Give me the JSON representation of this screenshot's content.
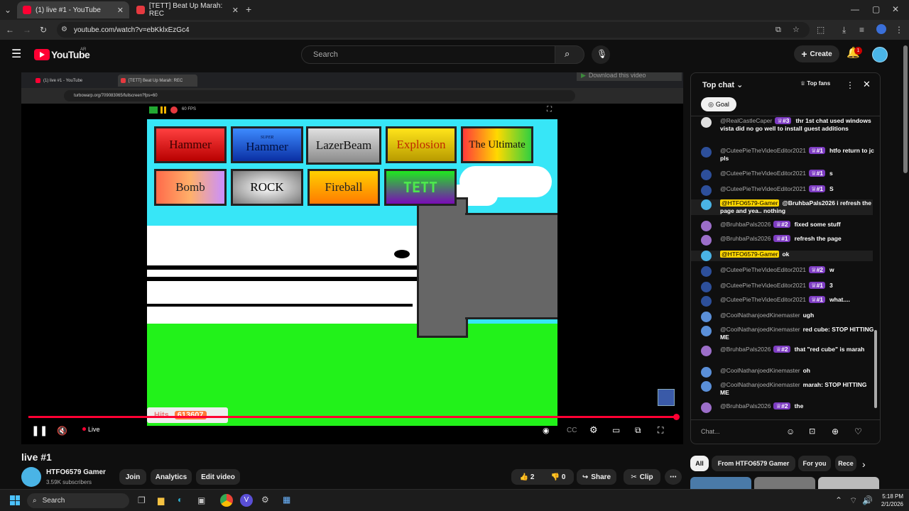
{
  "browser": {
    "tabs": [
      {
        "title": "(1) live #1 - YouTube",
        "active": true
      },
      {
        "title": "[TETT] Beat Up Marah: REC",
        "active": false
      }
    ],
    "url": "youtube.com/watch?v=ebKklxEzGc4"
  },
  "youtube": {
    "logo": "YouTube",
    "region": "AR",
    "search_placeholder": "Search",
    "create_label": "Create",
    "notif_count": "1"
  },
  "video": {
    "inner_tabs": [
      "(1) live #1 - YouTube",
      "[TETT] Beat Up Marah: REC"
    ],
    "inner_url": "turbowarp.org/709083065/fullscreen?fps=60",
    "fps": "60 FPS",
    "download_label": "Download this video",
    "weapons": [
      "Hammer",
      "Hammer",
      "LazerBeam",
      "Explosion",
      "The Ultimate",
      "Bomb",
      "ROCK",
      "Fireball",
      "TETT"
    ],
    "super_label": "SUPER",
    "hits_label": "Hits",
    "hits_value": "613607",
    "live_label": "Live",
    "progress_fraction": 1.0
  },
  "meta": {
    "title": "live #1",
    "channel": "HTFO6579 Gamer",
    "subscribers": "3.59K subscribers",
    "join": "Join",
    "analytics": "Analytics",
    "edit": "Edit video",
    "likes": "2",
    "dislikes": "0",
    "share": "Share",
    "clip": "Clip"
  },
  "chat": {
    "header": "Top chat",
    "top_fans": "Top fans",
    "goal": "Goal",
    "input_placeholder": "Chat...",
    "messages": [
      {
        "name": "@RealCastleCaper",
        "badge": "#3",
        "text": "thr 1st chat used windows vista did no go well to install guest additions",
        "highlight": false
      },
      {
        "name": "@CuteePieTheVideoEditor2021",
        "badge": "#1",
        "text": "htfo return to jc pls",
        "highlight": false
      },
      {
        "name": "@CuteePieTheVideoEditor2021",
        "badge": "#1",
        "text": "s",
        "highlight": false
      },
      {
        "name": "@CuteePieTheVideoEditor2021",
        "badge": "#1",
        "text": "S",
        "highlight": false
      },
      {
        "name": "@HTFO6579-Gamer",
        "badge": "",
        "text": "@BruhbaPals2026 i refresh the page and yea.. nothing",
        "highlight": true
      },
      {
        "name": "@BruhbaPals2026",
        "badge": "#2",
        "text": "fixed some stuff",
        "highlight": false
      },
      {
        "name": "@BruhbaPals2026",
        "badge": "#1",
        "text": "refresh the page",
        "highlight": false
      },
      {
        "name": "@HTFO6579-Gamer",
        "badge": "",
        "text": "ok",
        "highlight": true
      },
      {
        "name": "@CuteePieTheVideoEditor2021",
        "badge": "#2",
        "text": "w",
        "highlight": false
      },
      {
        "name": "@CuteePieTheVideoEditor2021",
        "badge": "#1",
        "text": "3",
        "highlight": false
      },
      {
        "name": "@CuteePieTheVideoEditor2021",
        "badge": "#1",
        "text": "what....",
        "highlight": false
      },
      {
        "name": "@CoolNathanjoedKinemaster",
        "badge": "",
        "text": "ugh",
        "highlight": false
      },
      {
        "name": "@CoolNathanjoedKinemaster",
        "badge": "",
        "text": "red cube: STOP HITTING ME",
        "highlight": false
      },
      {
        "name": "@BruhbaPals2026",
        "badge": "#2",
        "text": "that \"red cube\" is marah",
        "highlight": false
      },
      {
        "name": "@CoolNathanjoedKinemaster",
        "badge": "",
        "text": "oh",
        "highlight": false
      },
      {
        "name": "@CoolNathanjoedKinemaster",
        "badge": "",
        "text": "marah: STOP HITTING ME",
        "highlight": false
      },
      {
        "name": "@BruhbaPals2026",
        "badge": "#2",
        "text": "the",
        "highlight": false
      }
    ]
  },
  "filters": [
    "All",
    "From HTFO6579 Gamer",
    "For you",
    "Rece"
  ],
  "taskbar": {
    "search": "Search",
    "time": "5:18 PM",
    "date": "2/1/2026"
  },
  "colors": {
    "accent_red": "#ff0033",
    "badge_purple": "#7d3cc2",
    "highlight_yellow": "#ffd600",
    "sky": "#37e6f7",
    "grass": "#22f21a"
  }
}
